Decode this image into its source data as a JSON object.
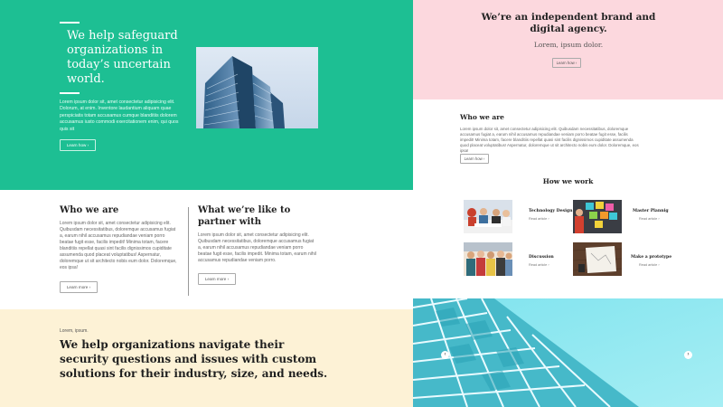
{
  "hero": {
    "title": "We help safeguard organizations in today’s uncertain world.",
    "body": "Lorem ipsum dolor sit, amet consectetur adipisicing elit. Dolorum, at enim. Inventore laudantium aliquam quae perspiciatis totam accusamus cumque blanditiis dolorem accusamus iusto commodi exercitationem enim, qui quos quis sit",
    "button": "Learn how ›",
    "photo_icon": "office-building-photo"
  },
  "who_left": {
    "title": "Who we are",
    "body": "Lorem ipsum dolor sit, amet consectetur adipisicing elit. Quibusdam necessitatibus, doloremque accusamus fugiat a, earum nihil accusamus repudiandae veniam porro beatae fugit esse, facilis impedit! Minima totam, facere blanditiis repellat quasi sint facilis dignissimos cupiditate assumenda quod placeat voluptatibus! Aspernatur, doloremque ut sit architecto nobis eum dolor. Doloremque, eos ipsa!",
    "button": "Learn more ›"
  },
  "partner": {
    "title": "What we’re like to partner with",
    "body": "Lorem ipsum dolor sit, amet consectetur adipisicing elit. Quibusdam necessitatibus, doloremque accusamus fugiat a, earum nihil accusamus repudiandae veniam porro beatae fugit esse, facilis impedit. Minima totam, earum nihil accusamus repudiandae veniam porro.",
    "button": "Learn more ›"
  },
  "statement": {
    "kicker": "Lorem, ipsum.",
    "text": "We help organizations navigate their security questions and issues with custom solutions for their industry, size, and needs."
  },
  "brand": {
    "title": "We’re an independent brand and digital agency.",
    "subtitle": "Lorem, ipsum dolor.",
    "button": "Learn how ›"
  },
  "who_right": {
    "title": "Who we are",
    "body": "Lorem ipsum dolor sit, amet consectetur adipisicing elit. Quibusdam necessitatibus, doloremque accusamus fugiat a, earum nihil accusamus repudiandae veniam porro beatae fugit esse, facilis impedit! Minima totam, facere blanditiis repellat quasi sint facilis dignissimos cupiditate assumenda quod placeat voluptatibus! Aspernatur, doloremque ut sit architecto nobis eum dolor. Doloremque, eos ipsa!",
    "button": "Learn how ›"
  },
  "how_we_work": {
    "title": "How we work",
    "cards": [
      {
        "label": "Technology Design",
        "more": "Read article ›",
        "icon": "team-meeting-photo"
      },
      {
        "label": "Master Plannig",
        "more": "Read article ›",
        "icon": "sticky-notes-photo"
      },
      {
        "label": "Discussion",
        "more": "Read article ›",
        "icon": "group-discussion-photo"
      },
      {
        "label": "Make a prototype",
        "more": "Read article ›",
        "icon": "desk-sketch-photo"
      }
    ]
  },
  "slider": {
    "prev": "‹",
    "next": "›",
    "photo_icon": "glass-facade-photo"
  },
  "colors": {
    "hero_bg": "#1dbf93",
    "brand_bg": "#fcd8de",
    "statement_bg": "#fdf2d6",
    "glass_bg": "#8be6f0"
  }
}
